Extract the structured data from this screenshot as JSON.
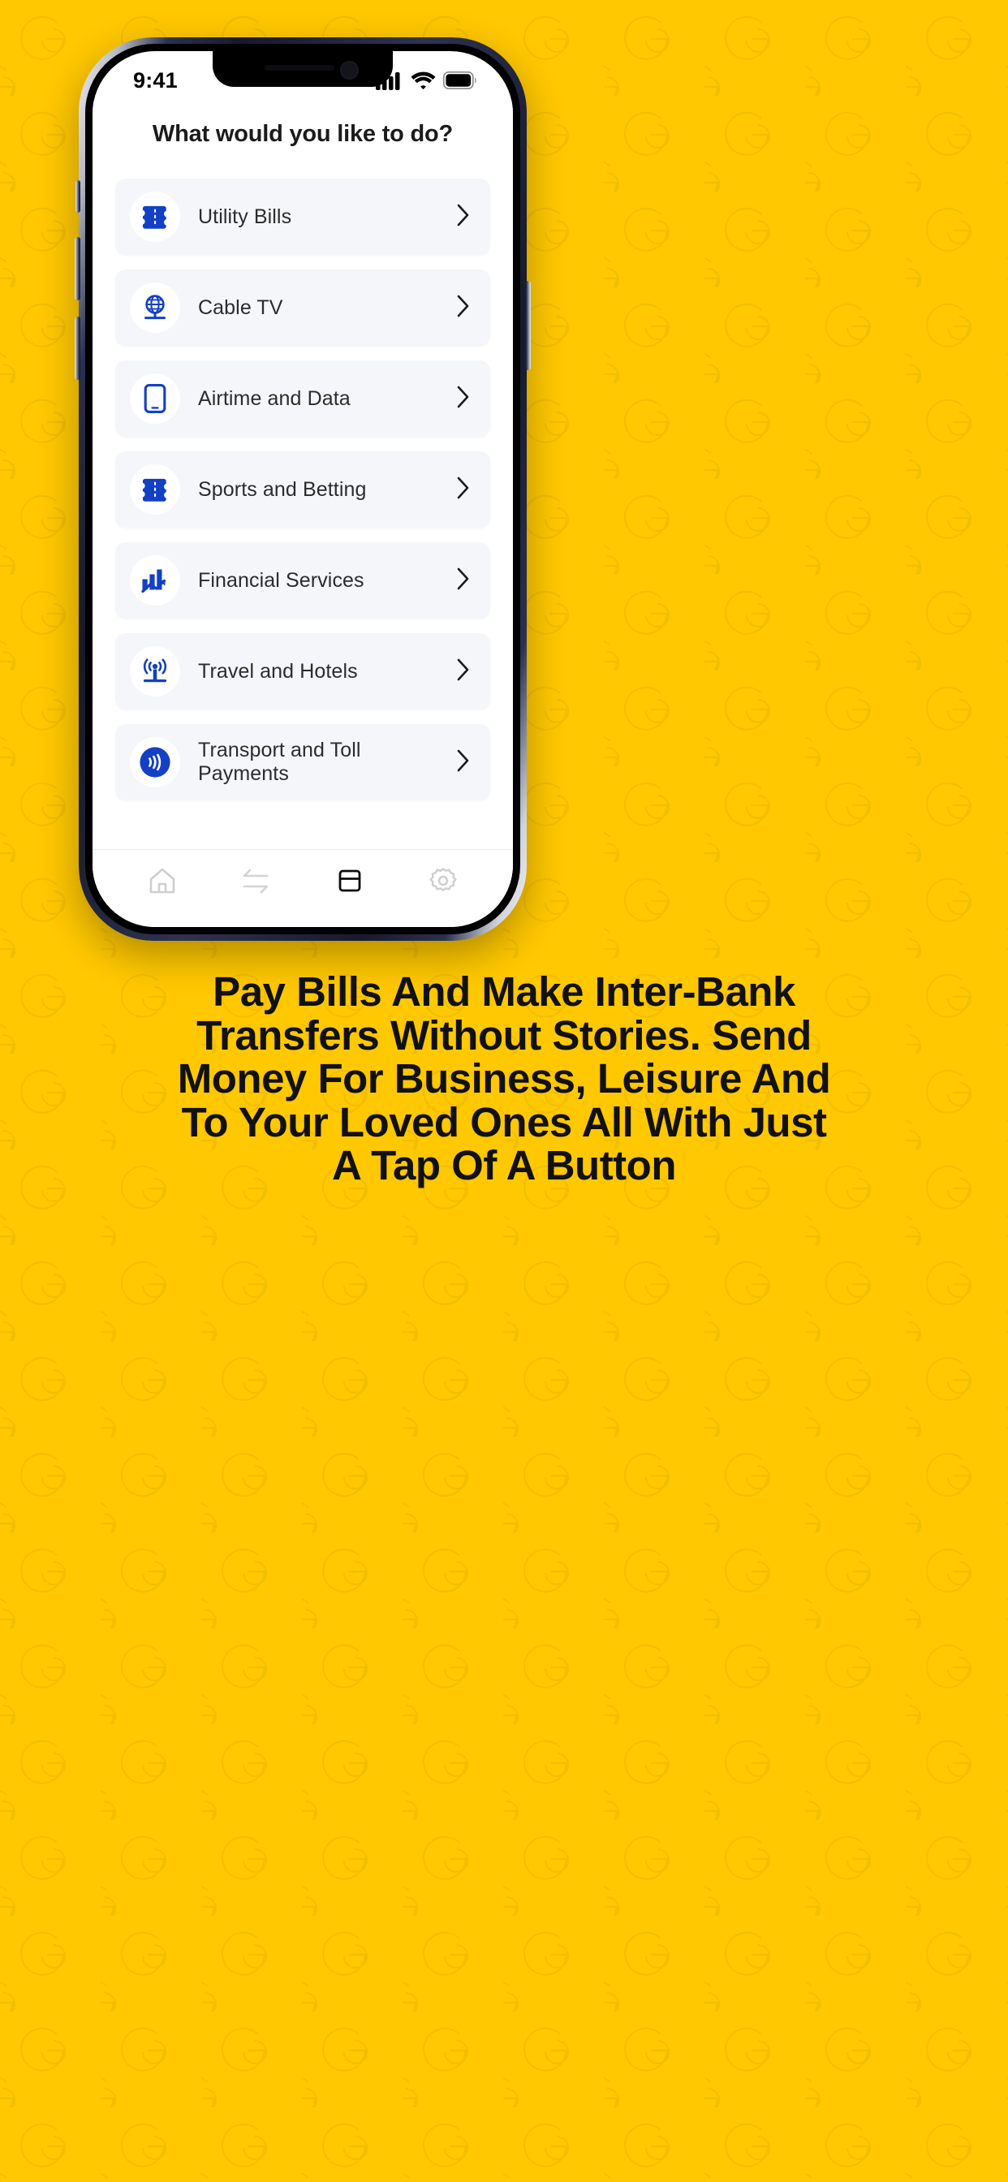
{
  "theme": {
    "background_yellow": "#FFC800",
    "brand_blue": "#1340C4",
    "card_gray": "#F4F6F9",
    "text_dark": "#2C2C2C",
    "caption_text": "#111111"
  },
  "status_bar": {
    "time": "9:41",
    "icons": [
      "cellular-signal-icon",
      "wifi-icon",
      "battery-icon"
    ],
    "battery_level": 100
  },
  "screen": {
    "title": "What would you like to do?"
  },
  "services": [
    {
      "label": "Utility Bills",
      "icon": "ticket-icon",
      "chevron": "chevron-right-icon"
    },
    {
      "label": "Cable TV",
      "icon": "satellite-dish-icon",
      "chevron": "chevron-right-icon"
    },
    {
      "label": "Airtime and Data",
      "icon": "smartphone-icon",
      "chevron": "chevron-right-icon"
    },
    {
      "label": "Sports and Betting",
      "icon": "ticket-icon",
      "chevron": "chevron-right-icon"
    },
    {
      "label": "Financial Services",
      "icon": "bar-chart-trend-icon",
      "chevron": "chevron-right-icon"
    },
    {
      "label": "Travel and Hotels",
      "icon": "broadcast-tower-icon",
      "chevron": "chevron-right-icon"
    },
    {
      "label": "Transport and Toll Payments",
      "icon": "contactless-pay-icon",
      "chevron": "chevron-right-icon"
    }
  ],
  "tab_bar": {
    "items": [
      {
        "name": "home",
        "icon": "home-icon",
        "active": false
      },
      {
        "name": "transfer",
        "icon": "transfer-arrows-icon",
        "active": false
      },
      {
        "name": "cards",
        "icon": "card-icon",
        "active": true
      },
      {
        "name": "settings",
        "icon": "gear-icon",
        "active": false
      }
    ]
  },
  "caption": {
    "lines": [
      "Pay Bills And Make Inter-Bank",
      "Transfers Without Stories. Send",
      "Money For Business, Leisure And",
      "To Your Loved Ones All With Just",
      "A Tap Of A Button"
    ]
  }
}
